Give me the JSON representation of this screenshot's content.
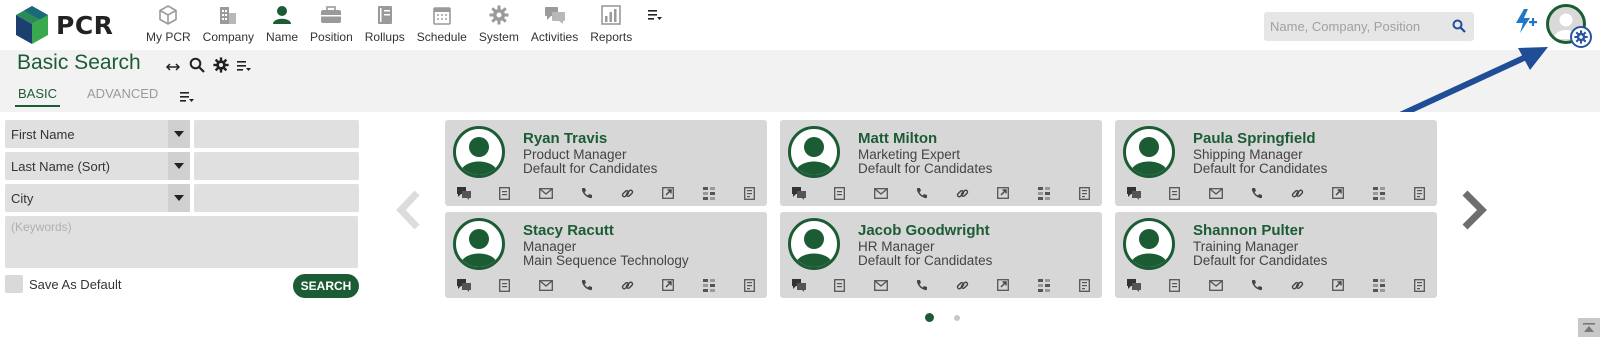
{
  "brand": {
    "name": "PCR",
    "accent": "#1c5c34",
    "arrow_color": "#1f4e97"
  },
  "nav": [
    {
      "label": "My PCR",
      "icon": "cube-icon"
    },
    {
      "label": "Company",
      "icon": "building-icon"
    },
    {
      "label": "Name",
      "icon": "person-icon"
    },
    {
      "label": "Position",
      "icon": "briefcase-icon"
    },
    {
      "label": "Rollups",
      "icon": "notebook-icon"
    },
    {
      "label": "Schedule",
      "icon": "calendar-icon"
    },
    {
      "label": "System",
      "icon": "gear-icon"
    },
    {
      "label": "Activities",
      "icon": "chat-icon"
    },
    {
      "label": "Reports",
      "icon": "bar-chart-icon"
    }
  ],
  "search": {
    "placeholder": "Name, Company, Position"
  },
  "page": {
    "title": "Basic Search"
  },
  "tabs": [
    {
      "label": "BASIC",
      "active": true
    },
    {
      "label": "ADVANCED",
      "active": false
    }
  ],
  "form": {
    "fields": [
      {
        "label": "First Name",
        "value": ""
      },
      {
        "label": "Last Name (Sort)",
        "value": ""
      },
      {
        "label": "City",
        "value": ""
      }
    ],
    "keywords_placeholder": "(Keywords)",
    "save_default_label": "Save As Default",
    "search_button": "SEARCH"
  },
  "cards": [
    {
      "name": "Ryan Travis",
      "title": "Product Manager",
      "company": "Default for Candidates"
    },
    {
      "name": "Matt Milton",
      "title": "Marketing Expert",
      "company": "Default for Candidates"
    },
    {
      "name": "Paula Springfield",
      "title": "Shipping Manager",
      "company": "Default for Candidates"
    },
    {
      "name": "Stacy Racutt",
      "title": "Manager",
      "company": "Main Sequence Technology"
    },
    {
      "name": "Jacob Goodwright",
      "title": "HR Manager",
      "company": "Default for Candidates"
    },
    {
      "name": "Shannon Pulter",
      "title": "Training Manager",
      "company": "Default for Candidates"
    }
  ],
  "card_actions": [
    "activities-icon",
    "notes-icon",
    "email-icon",
    "phone-icon",
    "link-icon",
    "open-external-icon",
    "pipeline-icon",
    "document-icon"
  ],
  "carousel": {
    "pages": 2,
    "current_page": 1
  }
}
